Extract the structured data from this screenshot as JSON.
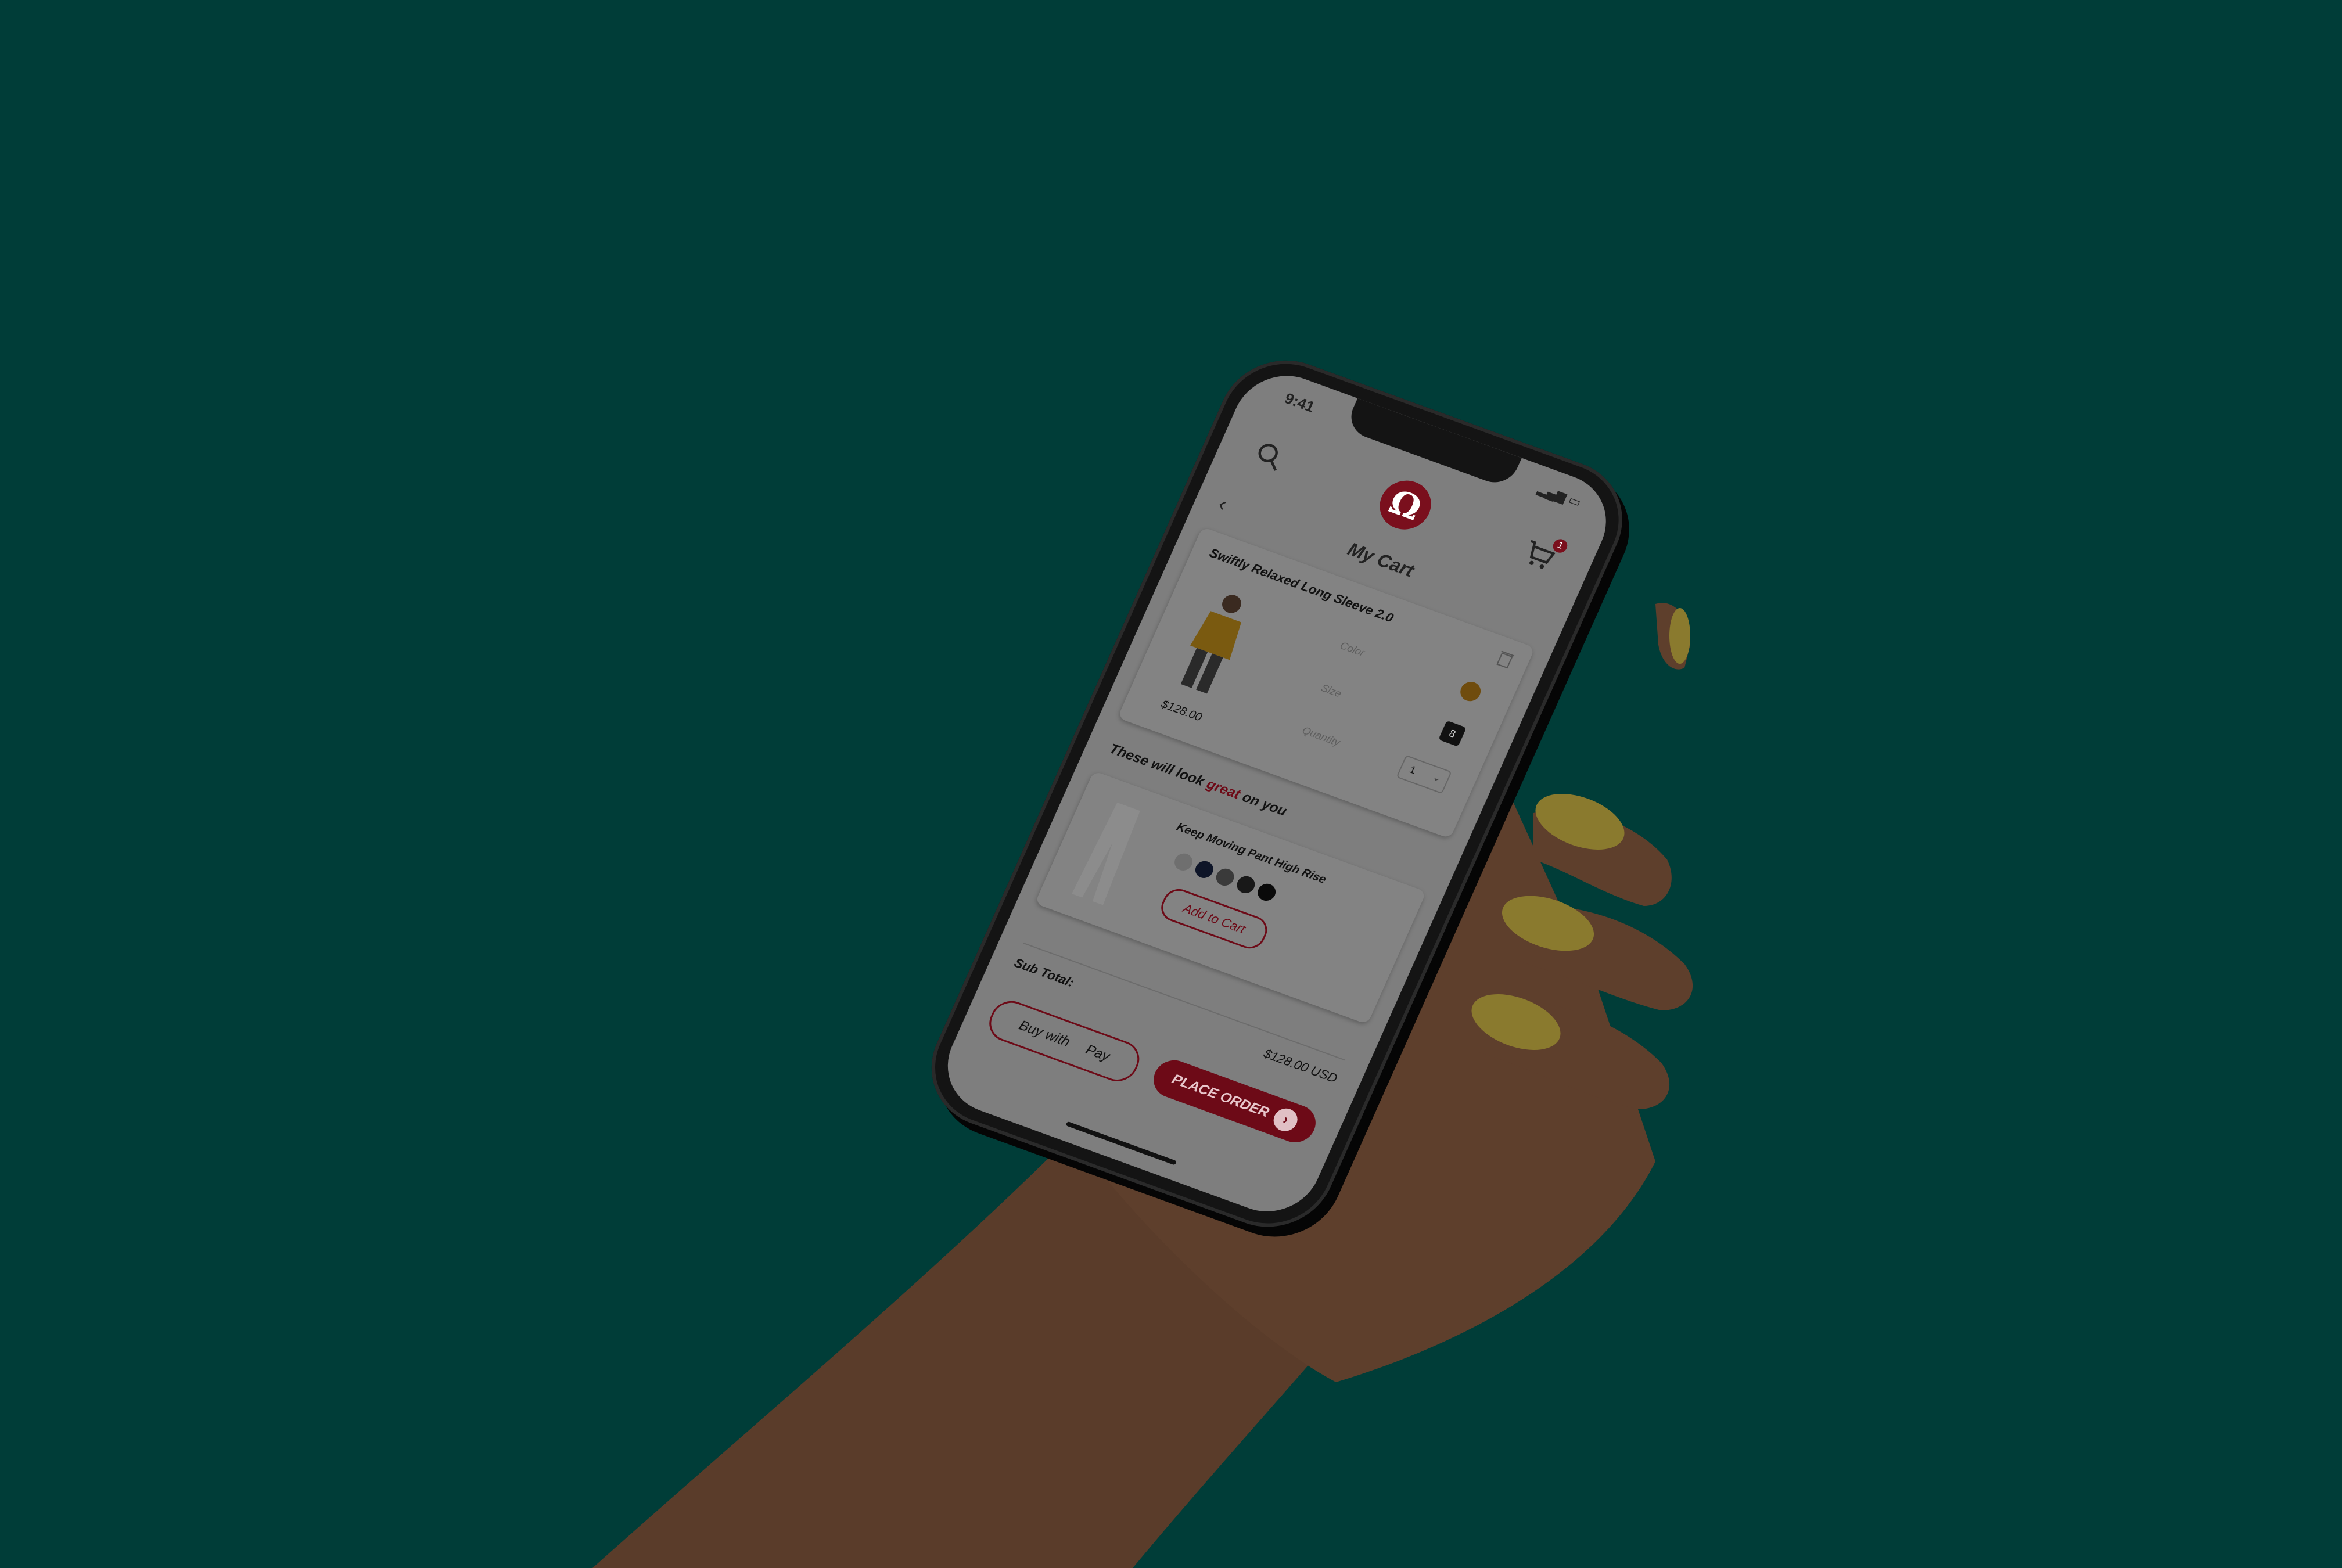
{
  "colors": {
    "background": "#003d38",
    "accent": "#c8102e",
    "skin": "#5a3c2a",
    "nail": "#8a7a2e"
  },
  "status_bar": {
    "time": "9:41",
    "icons": "wifi battery"
  },
  "header": {
    "search_icon": "search-icon",
    "logo_glyph": "Ω",
    "cart_icon": "cart-icon",
    "cart_count": "1"
  },
  "page": {
    "title": "My Cart",
    "back_icon": "chevron-left-icon"
  },
  "cart_item": {
    "name": "Swiftly Relaxed Long Sleeve 2.0",
    "price": "$128.00",
    "labels": {
      "color": "Color",
      "size": "Size",
      "quantity": "Quantity"
    },
    "size": "8",
    "quantity": "1",
    "color_swatch": "#d4a017"
  },
  "recommendations": {
    "title_pre": "These will look ",
    "title_accent": "great",
    "title_post": " on you",
    "item": {
      "name": "Keep Moving Pant High Rise",
      "swatches": [
        "#c7c7c7",
        "#1c2a4a",
        "#6b6b6b",
        "#2a2a2a",
        "#111111"
      ],
      "add_label": "Add to Cart"
    }
  },
  "summary": {
    "subtotal_label": "Sub Total:",
    "subtotal_value": "$128.00 USD"
  },
  "actions": {
    "applepay_label": "Buy with  Pay",
    "order_label": "PLACE ORDER",
    "order_arrow": "›"
  }
}
